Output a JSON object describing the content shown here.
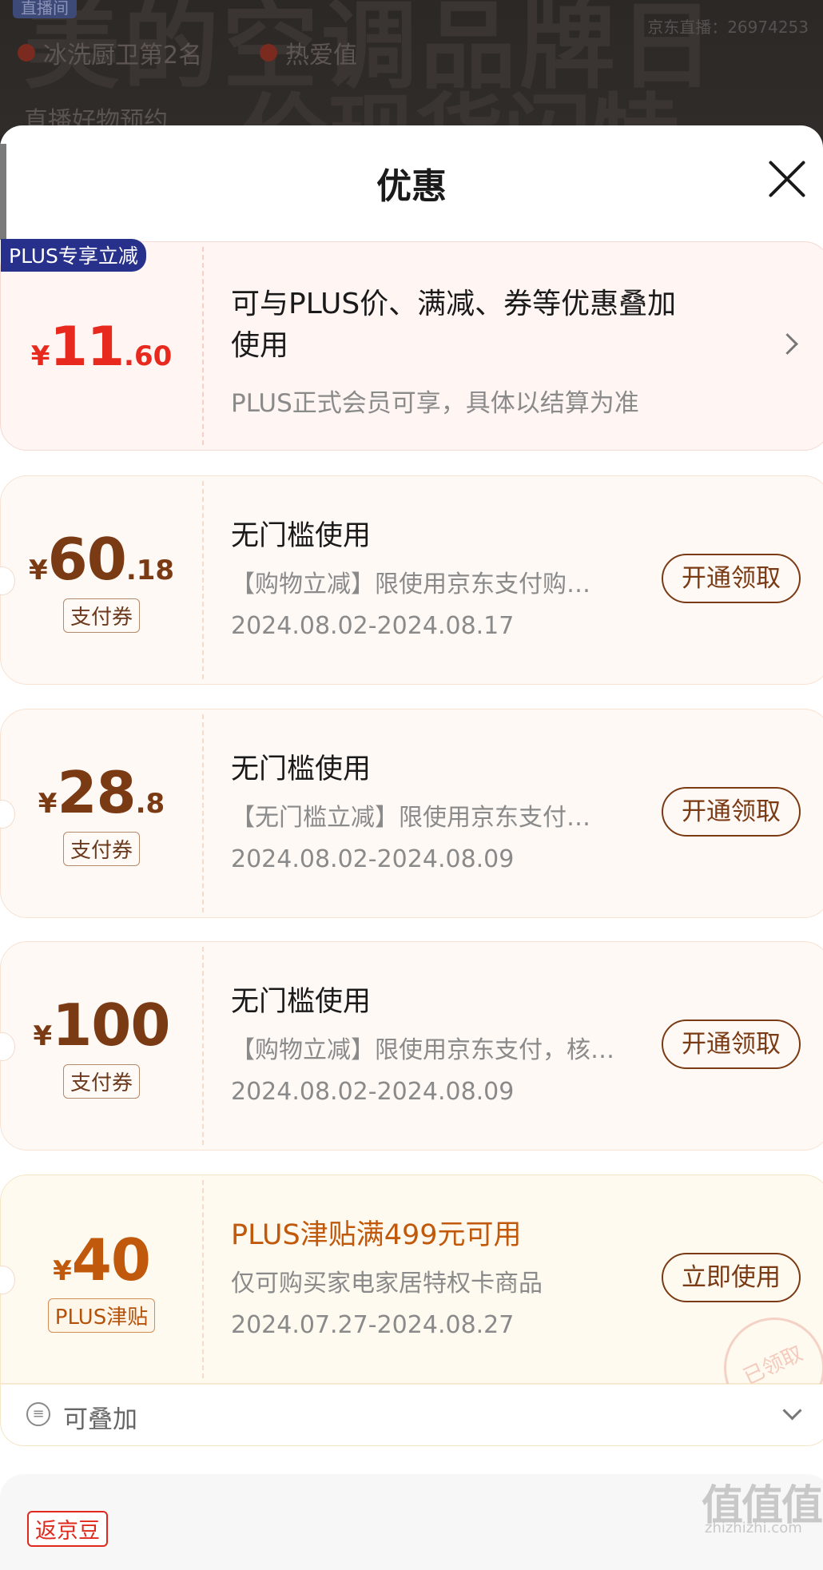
{
  "background": {
    "badge": "直播间",
    "rank_text": "冰洗厨卫第2名",
    "hot_text": "热爱值",
    "subtitle": "直播好物预约",
    "live_id": "京东直播：26974253",
    "big_text": "美的空调品牌日",
    "big_text2": "价现货闪特"
  },
  "sheet": {
    "title": "优惠",
    "close_icon": "close-icon"
  },
  "plus_offer": {
    "tag": "PLUS专享立减",
    "currency": "¥",
    "amount_int": "11",
    "amount_dec": ".60",
    "title": "可与PLUS价、满减、券等优惠叠加使用",
    "desc": "PLUS正式会员可享，具体以结算为准"
  },
  "coupons": [
    {
      "currency": "¥",
      "amount_int": "60",
      "amount_dec": ".18",
      "type": "支付券",
      "title": "无门槛使用",
      "desc": "【购物立减】限使用京东支付购…",
      "date": "2024.08.02-2024.08.17",
      "action": "开通领取"
    },
    {
      "currency": "¥",
      "amount_int": "28",
      "amount_dec": ".8",
      "type": "支付券",
      "title": "无门槛使用",
      "desc": "【无门槛立减】限使用京东支付…",
      "date": "2024.08.02-2024.08.09",
      "action": "开通领取"
    },
    {
      "currency": "¥",
      "amount_int": "100",
      "amount_dec": "",
      "type": "支付券",
      "title": "无门槛使用",
      "desc": "【购物立减】限使用京东支付，核…",
      "date": "2024.08.02-2024.08.09",
      "action": "开通领取"
    }
  ],
  "allowance": {
    "currency": "¥",
    "amount_int": "40",
    "type": "PLUS津贴",
    "title": "PLUS津贴满499元可用",
    "desc": "仅可购买家电家居特权卡商品",
    "date": "2024.07.27-2024.08.27",
    "action": "立即使用",
    "stamp": "已领取"
  },
  "stackable": {
    "label": "可叠加"
  },
  "bean_section": {
    "tag": "返京豆"
  },
  "watermark": {
    "main": "值值值",
    "sub": "zhizhizhi.com"
  },
  "colors": {
    "plus_red": "#e8291d",
    "coupon_brown": "#7a3a14",
    "plus_tag_blue": "#27308a",
    "allowance_orange": "#c0590b"
  }
}
